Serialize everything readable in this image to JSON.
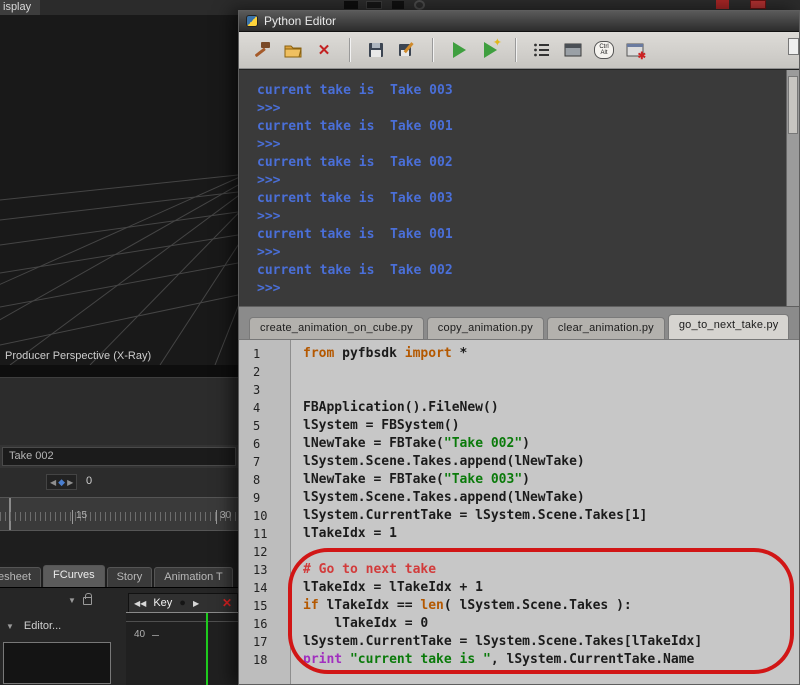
{
  "colors": {
    "console_text": "#4a6fd8",
    "keyword": "#b45800",
    "string": "#0a7a0a",
    "comment": "#d23b3b",
    "print_keyword": "#a12fbf",
    "annotation_red": "#d11616",
    "run_green": "#3f9f3f",
    "curve_green": "#1ecb1e"
  },
  "main_app": {
    "menu_partial": "isplay",
    "viewport_label": "Producer Perspective (X-Ray)",
    "take_field_value": "Take 002",
    "spinner_value": "0",
    "timeline_ticks": [
      "15",
      "30"
    ],
    "bottom_tabs": [
      {
        "label": "esheet",
        "active": false
      },
      {
        "label": "FCurves",
        "active": true
      },
      {
        "label": "Story",
        "active": false
      },
      {
        "label": "Animation T",
        "active": false
      }
    ],
    "transport": {
      "rewind": "◀◀",
      "key_label": "Key",
      "stop_dot": "●",
      "forward": "▶",
      "close": "✕"
    },
    "chevron": "▼",
    "editor_label": "Editor...",
    "graph_tick_label": "40"
  },
  "python_editor": {
    "title": "Python Editor",
    "toolbar": {
      "ctrl_label": "Ctrl",
      "alt_label": "Alt",
      "close_glyph": "✕",
      "spark_glyph": "✦",
      "debug_glyph": "✱"
    },
    "console_lines": [
      "current take is  Take 003",
      ">>> ",
      "current take is  Take 001",
      ">>> ",
      "current take is  Take 002",
      ">>> ",
      "current take is  Take 003",
      ">>> ",
      "current take is  Take 001",
      ">>> ",
      "current take is  Take 002",
      ">>> "
    ],
    "tabs": [
      {
        "label": "create_animation_on_cube.py",
        "active": false
      },
      {
        "label": "copy_animation.py",
        "active": false
      },
      {
        "label": "clear_animation.py",
        "active": false
      },
      {
        "label": "go_to_next_take.py",
        "active": true
      }
    ],
    "code_lines": [
      [
        [
          "kw",
          "from"
        ],
        [
          "pl",
          " pyfbsdk "
        ],
        [
          "kw",
          "import"
        ],
        [
          "pl",
          " *"
        ]
      ],
      [],
      [],
      [
        [
          "pl",
          "FBApplication().FileNew()"
        ]
      ],
      [
        [
          "pl",
          "lSystem = FBSystem()"
        ]
      ],
      [
        [
          "pl",
          "lNewTake = FBTake("
        ],
        [
          "str",
          "\"Take 002\""
        ],
        [
          "pl",
          ")"
        ]
      ],
      [
        [
          "pl",
          "lSystem.Scene.Takes.append(lNewTake)"
        ]
      ],
      [
        [
          "pl",
          "lNewTake = FBTake("
        ],
        [
          "str",
          "\"Take 003\""
        ],
        [
          "pl",
          ")"
        ]
      ],
      [
        [
          "pl",
          "lSystem.Scene.Takes.append(lNewTake)"
        ]
      ],
      [
        [
          "pl",
          "lSystem.CurrentTake = lSystem.Scene.Takes[1]"
        ]
      ],
      [
        [
          "pl",
          "lTakeIdx = 1"
        ]
      ],
      [],
      [
        [
          "com",
          "# Go to next take"
        ]
      ],
      [
        [
          "pl",
          "lTakeIdx = lTakeIdx + 1"
        ]
      ],
      [
        [
          "kw",
          "if"
        ],
        [
          "pl",
          " lTakeIdx == "
        ],
        [
          "bi",
          "len"
        ],
        [
          "pl",
          "( lSystem.Scene.Takes ):"
        ]
      ],
      [
        [
          "pl",
          "    lTakeIdx = 0"
        ]
      ],
      [
        [
          "pl",
          "lSystem.CurrentTake = lSystem.Scene.Takes[lTakeIdx]"
        ]
      ],
      [
        [
          "prn",
          "print"
        ],
        [
          "pl",
          " "
        ],
        [
          "str",
          "\"current take is \""
        ],
        [
          "pl",
          ", lSystem.CurrentTake.Name"
        ]
      ]
    ]
  }
}
